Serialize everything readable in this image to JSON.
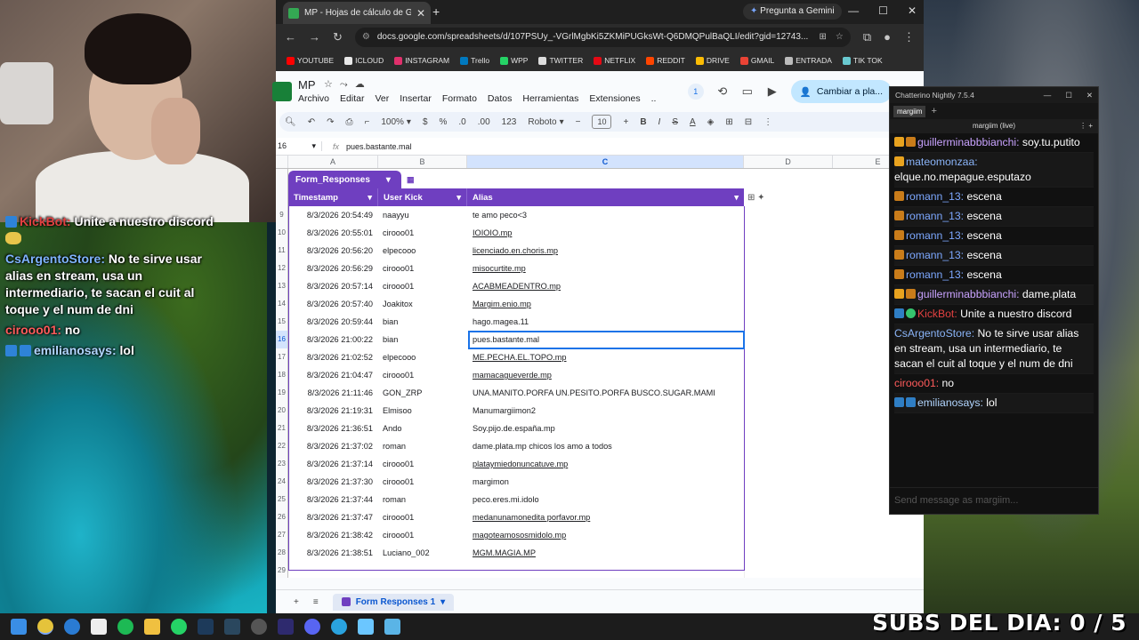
{
  "browser": {
    "tab_title": "MP - Hojas de cálculo de Goog",
    "gemini_label": "Pregunta a Gemini",
    "url": "docs.google.com/spreadsheets/d/107PSUy_-VGrlMgbKi5ZKMiPUGksWt-Q6DMQPulBaQLI/edit?gid=12743...",
    "bookmarks": [
      {
        "label": "YOUTUBE",
        "color": "#ff0000"
      },
      {
        "label": "ICLOUD",
        "color": "#e8e8e8"
      },
      {
        "label": "INSTAGRAM",
        "color": "#e1306c"
      },
      {
        "label": "Trello",
        "color": "#0079bf"
      },
      {
        "label": "WPP",
        "color": "#25d366"
      },
      {
        "label": "TWITTER",
        "color": "#dddddd"
      },
      {
        "label": "NETFLIX",
        "color": "#e50914"
      },
      {
        "label": "REDDIT",
        "color": "#ff4500"
      },
      {
        "label": "DRIVE",
        "color": "#fbbc04"
      },
      {
        "label": "GMAIL",
        "color": "#ea4335"
      },
      {
        "label": "ENTRADA",
        "color": "#bbbbbb"
      },
      {
        "label": "TIK TOK",
        "color": "#69c9d0"
      }
    ]
  },
  "sheets": {
    "doc_title": "MP",
    "menu": [
      "Archivo",
      "Editar",
      "Ver",
      "Insertar",
      "Formato",
      "Datos",
      "Herramientas",
      "Extensiones",
      ".."
    ],
    "share_label": "Cambiar a pla...",
    "comments_badge": "1",
    "toolbar": {
      "zoom": "100%",
      "currency": "$",
      "percent": "%",
      "dec_decrease": ".0",
      "dec_increase": ".00",
      "num_format": "123",
      "font": "Roboto",
      "font_size": "10"
    },
    "namebox": "16",
    "formula": "pues.bastante.mal",
    "columns": [
      "A",
      "B",
      "C",
      "D",
      "E"
    ],
    "table_name": "Form_Responses",
    "table_headers": [
      "Timestamp",
      "User Kick",
      "Alias"
    ],
    "rows": [
      {
        "n": "9",
        "ts": "8/3/2026 20:54:49",
        "user": "naayyu",
        "alias": "te amo peco<3",
        "link": false
      },
      {
        "n": "10",
        "ts": "8/3/2026 20:55:01",
        "user": "cirooo01",
        "alias": "IOIOIO.mp",
        "link": true
      },
      {
        "n": "11",
        "ts": "8/3/2026 20:56:20",
        "user": "elpecooo",
        "alias": "licenciado.en.choris.mp",
        "link": true
      },
      {
        "n": "12",
        "ts": "8/3/2026 20:56:29",
        "user": "cirooo01",
        "alias": "misocurtite.mp",
        "link": true
      },
      {
        "n": "13",
        "ts": "8/3/2026 20:57:14",
        "user": "cirooo01",
        "alias": "ACABMEADENTRO.mp",
        "link": true
      },
      {
        "n": "14",
        "ts": "8/3/2026 20:57:40",
        "user": "Joakitox",
        "alias": "Margim.enio.mp",
        "link": true
      },
      {
        "n": "15",
        "ts": "8/3/2026 20:59:44",
        "user": "bian",
        "alias": "hago.magea.11",
        "link": false
      },
      {
        "n": "16",
        "ts": "8/3/2026 21:00:22",
        "user": "bian",
        "alias": "pues.bastante.mal",
        "link": false
      },
      {
        "n": "17",
        "ts": "8/3/2026 21:02:52",
        "user": "elpecooo",
        "alias": "ME.PECHA.EL.TOPO.mp",
        "link": true
      },
      {
        "n": "18",
        "ts": "8/3/2026 21:04:47",
        "user": "cirooo01",
        "alias": "mamacagueverde.mp",
        "link": true
      },
      {
        "n": "19",
        "ts": "8/3/2026 21:11:46",
        "user": "GON_ZRP",
        "alias": "UNA.MANITO.PORFA  UN.PESITO.PORFA  BUSCO.SUGAR.MAMI",
        "link": false
      },
      {
        "n": "20",
        "ts": "8/3/2026 21:19:31",
        "user": "Elmisoo",
        "alias": "Manumargiimon2",
        "link": false
      },
      {
        "n": "21",
        "ts": "8/3/2026 21:36:51",
        "user": "Ando",
        "alias": "Soy.pijo.de.españa.mp",
        "link": false
      },
      {
        "n": "22",
        "ts": "8/3/2026 21:37:02",
        "user": "roman",
        "alias": "dame.plata.mp   chicos los amo a todos",
        "link": false
      },
      {
        "n": "23",
        "ts": "8/3/2026 21:37:14",
        "user": "cirooo01",
        "alias": "plataymiedonuncatuve.mp",
        "link": true
      },
      {
        "n": "24",
        "ts": "8/3/2026 21:37:30",
        "user": "cirooo01",
        "alias": "margimon",
        "link": false
      },
      {
        "n": "25",
        "ts": "8/3/2026 21:37:44",
        "user": "roman",
        "alias": "peco.eres.mi.idolo",
        "link": false
      },
      {
        "n": "26",
        "ts": "8/3/2026 21:37:47",
        "user": "cirooo01",
        "alias": "medanunamonedita porfavor.mp",
        "link": true
      },
      {
        "n": "27",
        "ts": "8/3/2026 21:38:42",
        "user": "cirooo01",
        "alias": "magoteamososmidolo.mp",
        "link": true
      },
      {
        "n": "28",
        "ts": "8/3/2026 21:38:51",
        "user": "Luciano_002",
        "alias": "MGM.MAGIA.MP",
        "link": true
      },
      {
        "n": "29",
        "ts": "",
        "user": "",
        "alias": "",
        "link": false
      }
    ],
    "sheet_tab": "Form Responses 1"
  },
  "chatterino": {
    "title": "Chatterino Nightly 7.5.4",
    "tab": "margiim",
    "channel": "margiim (live)",
    "input_placeholder": "Send message as margiim...",
    "messages": [
      {
        "user": "guillerminabbbianchi:",
        "color": "#c9a3ff",
        "text": "soy.tu.putito",
        "badges": [
          "y",
          "o"
        ]
      },
      {
        "user": "mateomonzaa:",
        "color": "#8ab4f8",
        "text": "elque.no.mepague.esputazo",
        "badges": [
          "y"
        ]
      },
      {
        "user": "romann_13:",
        "color": "#7da8ff",
        "text": "escena",
        "badges": [
          "o"
        ]
      },
      {
        "user": "romann_13:",
        "color": "#7da8ff",
        "text": "escena",
        "badges": [
          "o"
        ]
      },
      {
        "user": "romann_13:",
        "color": "#7da8ff",
        "text": "escena",
        "badges": [
          "o"
        ]
      },
      {
        "user": "romann_13:",
        "color": "#7da8ff",
        "text": "escena",
        "badges": [
          "o"
        ]
      },
      {
        "user": "romann_13:",
        "color": "#7da8ff",
        "text": "escena",
        "badges": [
          "o"
        ]
      },
      {
        "user": "guillerminabbbianchi:",
        "color": "#c9a3ff",
        "text": "dame.plata",
        "badges": [
          "y",
          "o"
        ]
      },
      {
        "user": "KickBot:",
        "color": "#e34141",
        "text": "Unite a nuestro discord",
        "badges": [
          "bl",
          "g"
        ]
      },
      {
        "user": "CsArgentoStore:",
        "color": "#8ab4f8",
        "text": "No te sirve usar alias en stream, usa un intermediario, te sacan el cuit al toque y el num de dni",
        "badges": []
      },
      {
        "user": "cirooo01:",
        "color": "#ff5b5b",
        "text": "no",
        "badges": []
      },
      {
        "user": "emilianosays:",
        "color": "#b2d6ff",
        "text": "lol",
        "badges": [
          "bl",
          "bl"
        ]
      }
    ]
  },
  "overlay_chat": [
    {
      "user": "KickBot:",
      "cls": "u1",
      "text": "Unite a nuestro discord"
    },
    {
      "user": "CsArgentoStore:",
      "cls": "u2",
      "text": "No te sirve usar alias en stream, usa un intermediario, te sacan el cuit al toque y el num de dni"
    },
    {
      "user": "cirooo01:",
      "cls": "u3",
      "text": "no"
    },
    {
      "user": "emilianosays:",
      "cls": "u4",
      "text": "lol"
    }
  ],
  "overlay_banner": "SUBS DEL DIA: 0 / 5"
}
